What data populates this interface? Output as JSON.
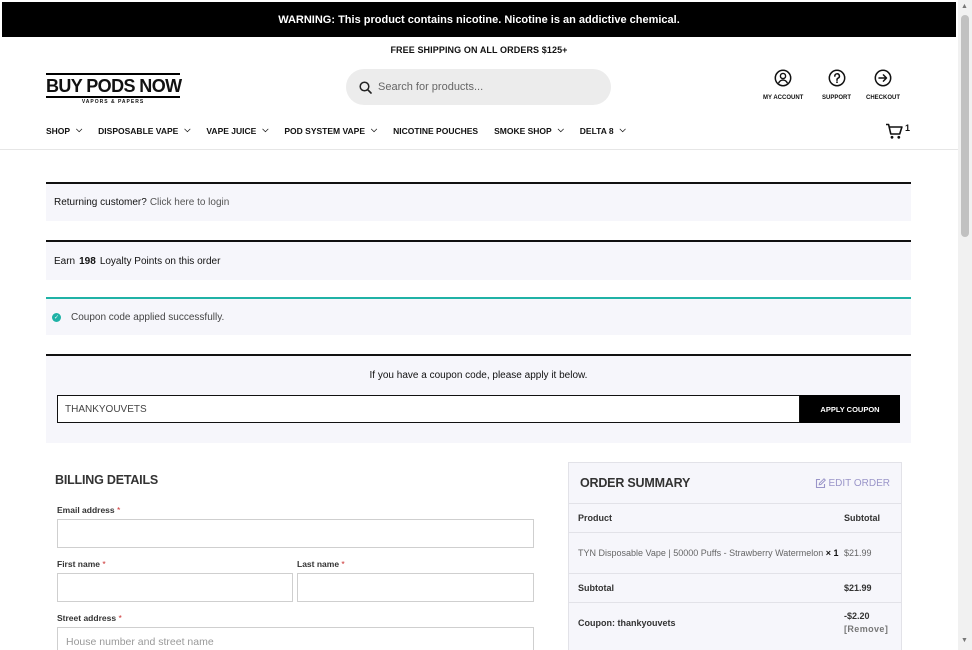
{
  "warning": "WARNING: This product contains nicotine. Nicotine is an addictive chemical.",
  "shipping_banner": "FREE SHIPPING ON ALL ORDERS $125+",
  "logo": {
    "main": "BUY PODS NOW",
    "sub": "VAPORS & PAPERS"
  },
  "search": {
    "placeholder": "Search for products..."
  },
  "header_links": {
    "account": "MY ACCOUNT",
    "support": "SUPPORT",
    "checkout": "CHECKOUT"
  },
  "nav": [
    {
      "label": "SHOP",
      "dropdown": true
    },
    {
      "label": "DISPOSABLE VAPE",
      "dropdown": true
    },
    {
      "label": "VAPE JUICE",
      "dropdown": true
    },
    {
      "label": "POD SYSTEM VAPE",
      "dropdown": true
    },
    {
      "label": "NICOTINE POUCHES",
      "dropdown": false
    },
    {
      "label": "SMOKE SHOP",
      "dropdown": true
    },
    {
      "label": "DELTA 8",
      "dropdown": true
    }
  ],
  "cart_count": "1",
  "notices": {
    "returning_prefix": "Returning customer?",
    "returning_link": "Click here to login",
    "earn_prefix": "Earn",
    "earn_points": "198",
    "earn_suffix": "Loyalty Points on this order",
    "coupon_success": "Coupon code applied successfully."
  },
  "coupon": {
    "prompt": "If you have a coupon code, please apply it below.",
    "value": "THANKYOUVETS",
    "button": "APPLY COUPON"
  },
  "billing": {
    "title": "BILLING DETAILS",
    "email_label": "Email address",
    "first_label": "First name",
    "last_label": "Last name",
    "street_label": "Street address",
    "street_placeholder": "House number and street name",
    "required_mark": "*"
  },
  "summary": {
    "title": "ORDER SUMMARY",
    "edit": "EDIT ORDER",
    "col_product": "Product",
    "col_subtotal": "Subtotal",
    "item_name": "TYN Disposable Vape | 50000 Puffs - Strawberry Watermelon",
    "item_qty": "× 1",
    "item_price": "$21.99",
    "subtotal_label": "Subtotal",
    "subtotal_value": "$21.99",
    "coupon_label": "Coupon: thankyouvets",
    "coupon_value": "-$2.20",
    "coupon_remove": "[Remove]"
  }
}
